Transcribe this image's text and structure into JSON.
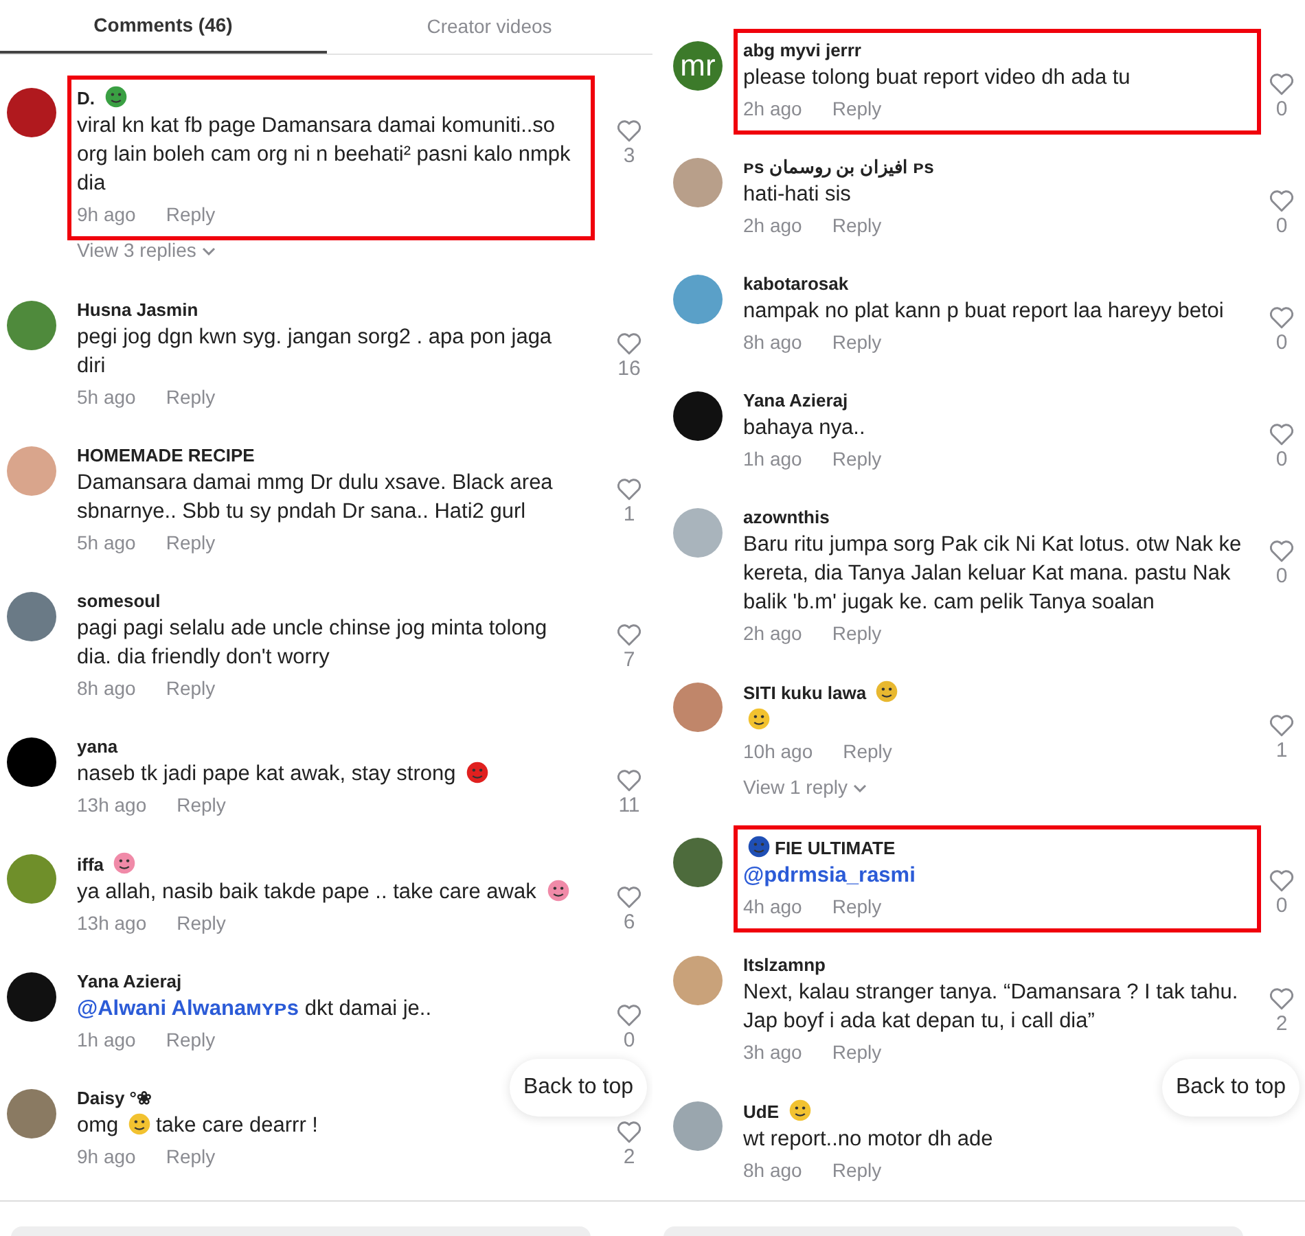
{
  "panels": [
    {
      "tabs": [
        {
          "label": "Comments (46)",
          "selected": true
        },
        {
          "label": "Creator videos",
          "selected": false
        }
      ],
      "comments": [
        {
          "color": "#b0191e",
          "name": [
            {
              "kind": "text",
              "text": "D."
            },
            {
              "kind": "emoji",
              "color": "#3aa043"
            }
          ],
          "body": [
            {
              "kind": "text",
              "text": "viral kn kat fb page Damansara damai komuniti..so org lain boleh cam org ni n beehati² pasni kalo nmpk dia"
            }
          ],
          "time": "9h ago",
          "reply": "Reply",
          "likes": "3",
          "highlighted": true,
          "more": "View 3 replies"
        },
        {
          "color": "#4f8a3c",
          "name": [
            {
              "kind": "text",
              "text": "Husna Jasmin"
            }
          ],
          "body": [
            {
              "kind": "text",
              "text": "pegi jog dgn kwn syg. jangan sorg2 . apa pon jaga diri"
            }
          ],
          "time": "5h ago",
          "reply": "Reply",
          "likes": "16",
          "highlighted": false
        },
        {
          "color": "#d9a58c",
          "name": [
            {
              "kind": "text",
              "text": "HOMEMADE RECIPE"
            }
          ],
          "body": [
            {
              "kind": "text",
              "text": "Damansara damai mmg Dr dulu xsave. Black area sbnarnye.. Sbb tu sy pndah Dr sana.. Hati2 gurl"
            }
          ],
          "time": "5h ago",
          "reply": "Reply",
          "likes": "1",
          "highlighted": false
        },
        {
          "color": "#6a7a86",
          "name": [
            {
              "kind": "text",
              "text": "somesoul"
            }
          ],
          "body": [
            {
              "kind": "text",
              "text": "pagi pagi selalu ade uncle chinse jog minta tolong dia. dia friendly don't worry"
            }
          ],
          "time": "8h ago",
          "reply": "Reply",
          "likes": "7",
          "highlighted": false
        },
        {
          "color": "#000000",
          "name": [
            {
              "kind": "text",
              "text": "yana"
            }
          ],
          "body": [
            {
              "kind": "text",
              "text": "naseb tk jadi pape kat awak, stay strong"
            },
            {
              "kind": "emoji",
              "color": "#e0201f"
            }
          ],
          "time": "13h ago",
          "reply": "Reply",
          "likes": "11",
          "highlighted": false
        },
        {
          "color": "#6f8f2a",
          "name": [
            {
              "kind": "text",
              "text": "iffa"
            },
            {
              "kind": "emoji",
              "color": "#f08aa8"
            }
          ],
          "body": [
            {
              "kind": "text",
              "text": "ya allah, nasib baik takde pape .. take care awak"
            },
            {
              "kind": "emoji",
              "color": "#f08aa8"
            }
          ],
          "time": "13h ago",
          "reply": "Reply",
          "likes": "6",
          "highlighted": false
        },
        {
          "color": "#111111",
          "name": [
            {
              "kind": "text",
              "text": "Yana Azieraj"
            }
          ],
          "body": [
            {
              "kind": "mention",
              "text": "@Alwani Alwanaᴍʏᴘs"
            },
            {
              "kind": "text",
              "text": "dkt damai je.."
            }
          ],
          "time": "1h ago",
          "reply": "Reply",
          "likes": "0",
          "highlighted": false
        },
        {
          "color": "#8a7a62",
          "name": [
            {
              "kind": "text",
              "text": "Daisy °❀"
            }
          ],
          "body": [
            {
              "kind": "text",
              "text": "omg"
            },
            {
              "kind": "emoji",
              "color": "#f2c230"
            },
            {
              "kind": "text",
              "text": "take care dearrr !"
            }
          ],
          "time": "9h ago",
          "reply": "Reply",
          "likes": "2",
          "highlighted": false
        }
      ],
      "back_to_top": "Back to top"
    },
    {
      "comments": [
        {
          "color": "#3c7a2a",
          "avatar_text": "mr",
          "name": [
            {
              "kind": "text",
              "text": "abg myvi jerrr"
            }
          ],
          "body": [
            {
              "kind": "text",
              "text": "please tolong buat report video dh ada tu"
            }
          ],
          "time": "2h ago",
          "reply": "Reply",
          "likes": "0",
          "highlighted": true
        },
        {
          "color": "#b89f8a",
          "name": [
            {
              "kind": "text",
              "text": "ᴘs افيزان بن روسمان ᴘs"
            }
          ],
          "body": [
            {
              "kind": "text",
              "text": "hati-hati sis"
            }
          ],
          "time": "2h ago",
          "reply": "Reply",
          "likes": "0",
          "highlighted": false
        },
        {
          "color": "#5aa0c8",
          "name": [
            {
              "kind": "text",
              "text": "kabotarosak"
            }
          ],
          "body": [
            {
              "kind": "text",
              "text": "nampak no plat kann p buat report laa hareyy betoi"
            }
          ],
          "time": "8h ago",
          "reply": "Reply",
          "likes": "0",
          "highlighted": false
        },
        {
          "color": "#111111",
          "name": [
            {
              "kind": "text",
              "text": "Yana Azieraj"
            }
          ],
          "body": [
            {
              "kind": "text",
              "text": "bahaya nya.."
            }
          ],
          "time": "1h ago",
          "reply": "Reply",
          "likes": "0",
          "highlighted": false
        },
        {
          "color": "#a9b4bc",
          "name": [
            {
              "kind": "text",
              "text": "azownthis"
            }
          ],
          "body": [
            {
              "kind": "text",
              "text": "Baru ritu jumpa sorg Pak cik Ni Kat lotus. otw Nak ke kereta, dia Tanya Jalan keluar Kat mana. pastu Nak balik 'b.m' jugak ke. cam pelik Tanya soalan"
            }
          ],
          "time": "2h ago",
          "reply": "Reply",
          "likes": "0",
          "highlighted": false
        },
        {
          "color": "#c0866a",
          "name": [
            {
              "kind": "text",
              "text": "SITI kuku lawa"
            },
            {
              "kind": "emoji",
              "color": "#e8b830"
            }
          ],
          "body": [
            {
              "kind": "emoji",
              "color": "#f2c230"
            }
          ],
          "time": "10h ago",
          "reply": "Reply",
          "likes": "1",
          "highlighted": false,
          "more": "View 1 reply"
        },
        {
          "color": "#4d6b3c",
          "name": [
            {
              "kind": "emoji",
              "color": "#1f4fb5"
            },
            {
              "kind": "text",
              "text": "FIE ULTIMATE"
            }
          ],
          "body": [
            {
              "kind": "mention",
              "text": "@pdrmsia_rasmi"
            }
          ],
          "time": "4h ago",
          "reply": "Reply",
          "likes": "0",
          "highlighted": true
        },
        {
          "color": "#c9a27a",
          "name": [
            {
              "kind": "text",
              "text": "Itslzamnp"
            }
          ],
          "body": [
            {
              "kind": "text",
              "text": "Next, kalau stranger tanya. “Damansara ? I tak tahu. Jap boyf i ada kat depan tu, i call dia”"
            }
          ],
          "time": "3h ago",
          "reply": "Reply",
          "likes": "2",
          "highlighted": false
        },
        {
          "color": "#9aa6ae",
          "name": [
            {
              "kind": "text",
              "text": "UdE"
            },
            {
              "kind": "emoji",
              "color": "#f2c230"
            }
          ],
          "body": [
            {
              "kind": "text",
              "text": "wt report..no motor dh ade"
            }
          ],
          "time": "8h ago",
          "reply": "Reply",
          "highlighted": false
        }
      ],
      "back_to_top": "Back to top"
    }
  ]
}
